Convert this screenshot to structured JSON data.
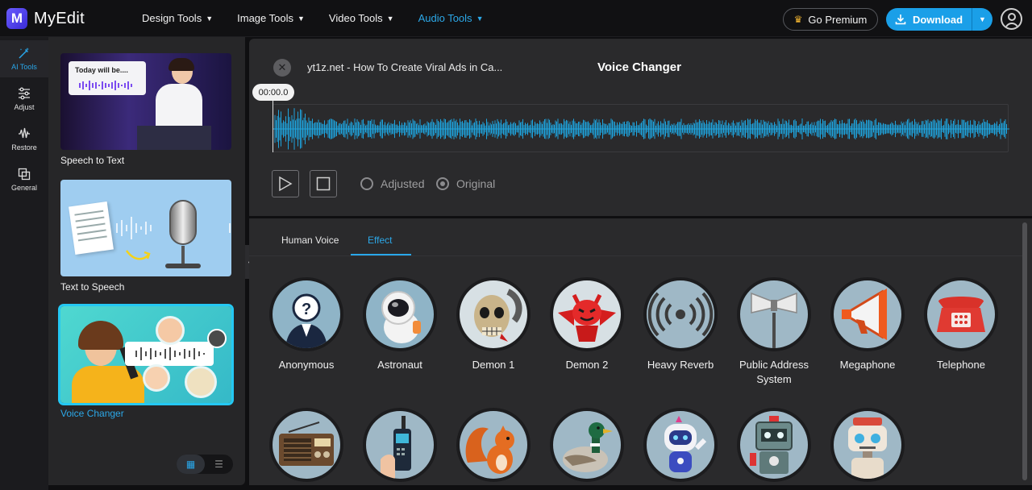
{
  "app": {
    "name": "MyEdit",
    "logo_letter": "M"
  },
  "nav": {
    "items": [
      {
        "label": "Design Tools",
        "active": false
      },
      {
        "label": "Image Tools",
        "active": false
      },
      {
        "label": "Video Tools",
        "active": false
      },
      {
        "label": "Audio Tools",
        "active": true
      }
    ],
    "premium_label": "Go Premium",
    "download_label": "Download"
  },
  "rail": {
    "items": [
      {
        "label": "AI Tools",
        "icon": "magic-wand-icon",
        "active": true
      },
      {
        "label": "Adjust",
        "icon": "sliders-icon",
        "active": false
      },
      {
        "label": "Restore",
        "icon": "waveform-icon",
        "active": false
      },
      {
        "label": "General",
        "icon": "layers-icon",
        "active": false
      }
    ]
  },
  "tools": {
    "cards": [
      {
        "label": "Speech to Text",
        "thumb_text": "Today will be....",
        "selected": false
      },
      {
        "label": "Text to Speech",
        "selected": false
      },
      {
        "label": "Voice Changer",
        "selected": true
      }
    ]
  },
  "editor": {
    "file_name": "yt1z.net - How To Create Viral Ads in Ca...",
    "title": "Voice Changer",
    "time": "00:00.0",
    "radio_adjusted": "Adjusted",
    "radio_original": "Original",
    "selected_mode": "Original"
  },
  "effects_panel": {
    "tabs": [
      {
        "label": "Human Voice",
        "active": false
      },
      {
        "label": "Effect",
        "active": true
      }
    ],
    "effects": [
      {
        "label": "Anonymous",
        "icon": "anonymous-icon"
      },
      {
        "label": "Astronaut",
        "icon": "astronaut-icon"
      },
      {
        "label": "Demon 1",
        "icon": "skull-icon"
      },
      {
        "label": "Demon 2",
        "icon": "red-devil-icon"
      },
      {
        "label": "Heavy Reverb",
        "icon": "reverb-icon"
      },
      {
        "label": "Public Address System",
        "icon": "loudspeaker-icon"
      },
      {
        "label": "Megaphone",
        "icon": "megaphone-icon"
      },
      {
        "label": "Telephone",
        "icon": "telephone-icon"
      },
      {
        "label": "",
        "icon": "radio-icon"
      },
      {
        "label": "",
        "icon": "walkie-talkie-icon"
      },
      {
        "label": "",
        "icon": "squirrel-icon"
      },
      {
        "label": "",
        "icon": "duck-icon"
      },
      {
        "label": "",
        "icon": "robot-icon"
      },
      {
        "label": "",
        "icon": "robot-2-icon"
      },
      {
        "label": "",
        "icon": "robot-3-icon"
      }
    ]
  },
  "colors": {
    "accent": "#29a7ea",
    "selected_outline": "#24c8f3",
    "panel": "#2a2a2c"
  }
}
